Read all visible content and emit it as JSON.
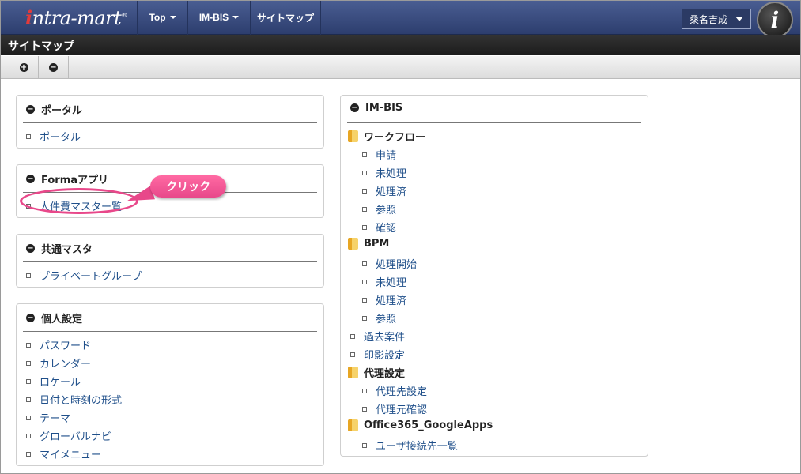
{
  "header": {
    "logo_text": "intra-mart",
    "logo_reg": "®",
    "nav": [
      {
        "label": "Top",
        "dropdown": true
      },
      {
        "label": "IM-BIS",
        "dropdown": true
      },
      {
        "label": "サイトマップ",
        "dropdown": false
      }
    ],
    "user_name": "桑名吉成",
    "avatar_letter": "i"
  },
  "page_title": "サイトマップ",
  "toolbar": {
    "expand_icon": "plus-circle-icon",
    "collapse_icon": "minus-circle-icon"
  },
  "left_panels": [
    {
      "title": "ポータル",
      "items": [
        "ポータル"
      ]
    },
    {
      "title": "Formaアプリ",
      "items": [
        "人件費マスター覧"
      ]
    },
    {
      "title": "共通マスタ",
      "items": [
        "プライベートグループ"
      ]
    },
    {
      "title": "個人設定",
      "items": [
        "パスワード",
        "カレンダー",
        "ロケール",
        "日付と時刻の形式",
        "テーマ",
        "グローバルナビ",
        "マイメニュー"
      ]
    }
  ],
  "right_panel": {
    "title": "IM-BIS",
    "workflow": {
      "label": "ワークフロー",
      "items": [
        "申請",
        "未処理",
        "処理済",
        "参照",
        "確認"
      ]
    },
    "bpm": {
      "label": "BPM",
      "items": [
        "処理開始",
        "未処理",
        "処理済",
        "参照"
      ]
    },
    "links": [
      "過去案件",
      "印影設定"
    ],
    "proxy": {
      "label": "代理設定",
      "items": [
        "代理先設定",
        "代理元確認"
      ]
    },
    "office": {
      "label": "Office365_GoogleApps",
      "items": [
        "ユーザ接続先一覧"
      ]
    }
  },
  "annotation": {
    "callout_text": "クリック",
    "color": "#e8488a"
  }
}
